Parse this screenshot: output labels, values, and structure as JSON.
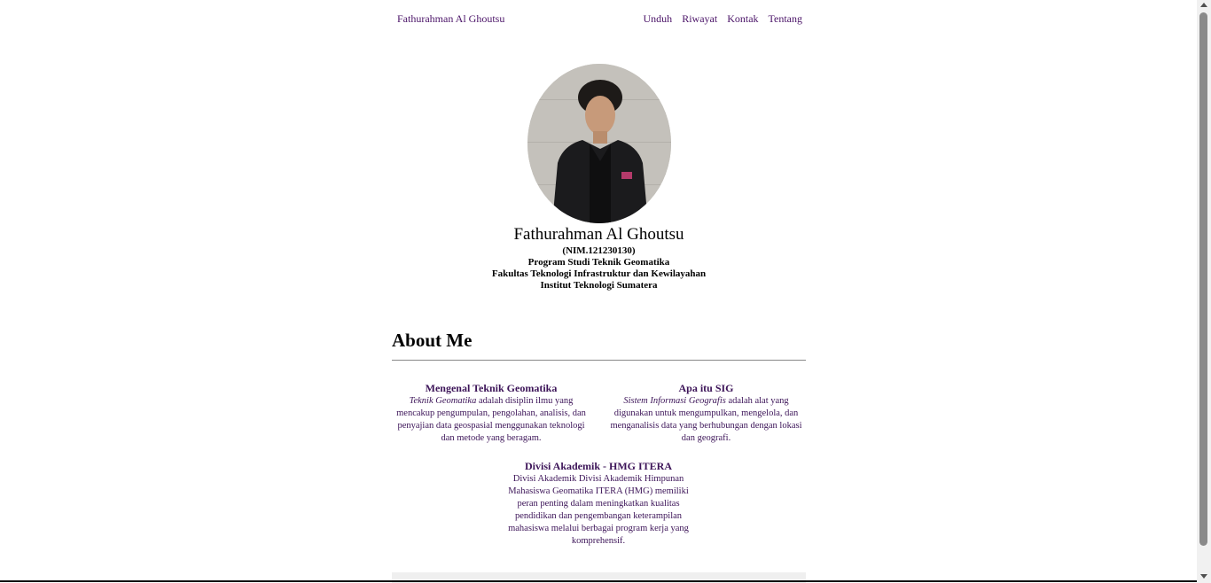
{
  "nav": {
    "brand": "Fathurahman Al Ghoutsu",
    "links": [
      "Unduh",
      "Riwayat",
      "Kontak",
      "Tentang"
    ]
  },
  "profile": {
    "name": "Fathurahman Al Ghoutsu",
    "nim": "(NIM.121230130)",
    "program": "Program Studi Teknik Geomatika",
    "faculty": "Fakultas Teknologi Infrastruktur dan Kewilayahan",
    "institute": "Institut Teknologi Sumatera"
  },
  "about": {
    "title": "About Me",
    "cards": [
      {
        "title": "Mengenal Teknik Geomatika",
        "emphasis": "Teknik Geomatika",
        "text": " adalah disiplin ilmu yang mencakup pengumpulan, pengolahan, analisis, dan penyajian data geospasial menggunakan teknologi dan metode yang beragam."
      },
      {
        "title": "Apa itu SIG",
        "emphasis": "Sistem Informasi Geografis",
        "text": " adalah alat yang digunakan untuk mengumpulkan, mengelola, dan menganalisis data yang berhubungan dengan lokasi dan geografi."
      },
      {
        "title": "Divisi Akademik - HMG ITERA",
        "text": "Divisi Akademik Divisi Akademik Himpunan Mahasiswa Geomatika ITERA (HMG) memiliki peran penting dalam meningkatkan kualitas pendidikan dan pengembangan keterampilan mahasiswa melalui berbagai program kerja yang komprehensif."
      }
    ]
  },
  "colors": {
    "link": "#4b1468",
    "card_text": "#3c1458",
    "divider": "#888888"
  }
}
